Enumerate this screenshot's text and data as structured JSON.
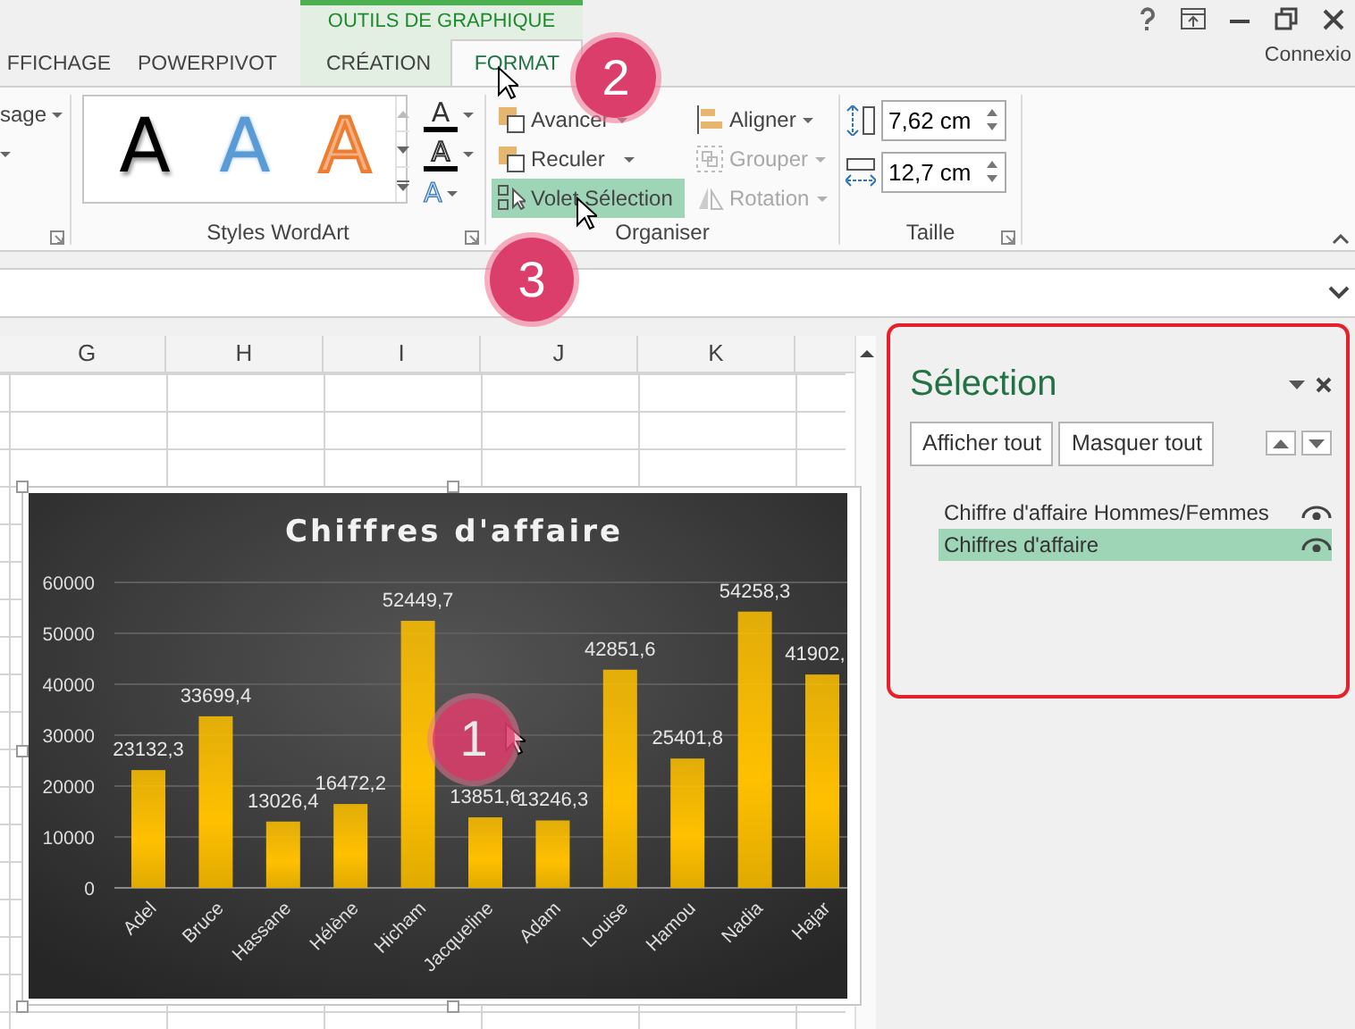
{
  "contextual_tab_group": {
    "title": "OUTILS DE GRAPHIQUE"
  },
  "tabs": [
    {
      "label": "FFICHAGE",
      "selected": false,
      "contextual": false
    },
    {
      "label": "POWERPIVOT",
      "selected": false,
      "contextual": false
    },
    {
      "label": "CRÉATION",
      "selected": false,
      "contextual": true
    },
    {
      "label": "FORMAT",
      "selected": true,
      "contextual": true
    }
  ],
  "account": "Connexio",
  "ribbon": {
    "partial_group": {
      "items": [
        "sage"
      ]
    },
    "wordart_group": {
      "title": "Styles WordArt",
      "gallery": [
        {
          "letter": "A",
          "color": "#000000"
        },
        {
          "letter": "A",
          "color": "#5b9bd5"
        },
        {
          "letter": "A",
          "color": "#f4b183"
        }
      ],
      "format_buttons": [
        "A",
        "A",
        "A"
      ]
    },
    "arrange_group": {
      "title": "Organiser",
      "buttons": [
        {
          "label": "Avancer",
          "disabled": false,
          "selected": false,
          "menu": true
        },
        {
          "label": "Reculer",
          "disabled": false,
          "selected": false,
          "menu": true
        },
        {
          "label": "Volet Sélection",
          "disabled": false,
          "selected": true,
          "menu": false
        },
        {
          "label": "Aligner",
          "disabled": false,
          "selected": false,
          "menu": true
        },
        {
          "label": "Grouper",
          "disabled": true,
          "selected": false,
          "menu": true
        },
        {
          "label": "Rotation",
          "disabled": true,
          "selected": false,
          "menu": true
        }
      ]
    },
    "size_group": {
      "title": "Taille",
      "fields": [
        {
          "value": "7,62 cm"
        },
        {
          "value": "12,7 cm"
        }
      ]
    }
  },
  "sheet": {
    "columns": [
      "G",
      "H",
      "I",
      "J",
      "K"
    ]
  },
  "chart": {
    "chart_data": {
      "type": "bar",
      "title": "Chiffres d'affaire",
      "categories": [
        "Adel",
        "Bruce",
        "Hassane",
        "Hélène",
        "Hicham",
        "Jacqueline",
        "Adam",
        "Louise",
        "Hamou",
        "Nadia",
        "Hajar"
      ],
      "grid": true,
      "series": [
        {
          "color": "#ffc000",
          "values": [
            23132.3,
            33699.4,
            13026.4,
            16472.2,
            52449.7,
            13851.6,
            13246.3,
            42851.6,
            25401.8,
            54258.3,
            41902
          ]
        }
      ],
      "value_labels": [
        "23132,3",
        "33699,4",
        "13026,4",
        "16472,2",
        "52449,7",
        "13851,6",
        "13246,3",
        "42851,6",
        "25401,8",
        "54258,3",
        "41902,"
      ],
      "ylim": [
        0,
        60000
      ],
      "yticks": [
        0,
        10000,
        20000,
        30000,
        40000,
        50000,
        60000
      ]
    }
  },
  "selection_pane": {
    "title": "Sélection",
    "buttons": [
      "Afficher tout",
      "Masquer tout"
    ],
    "items": [
      {
        "label": "Chiffre d'affaire Hommes/Femmes",
        "selected": false,
        "visible": true
      },
      {
        "label": "Chiffres d'affaire",
        "selected": true,
        "visible": true
      }
    ]
  },
  "callouts": [
    "1",
    "2",
    "3"
  ]
}
